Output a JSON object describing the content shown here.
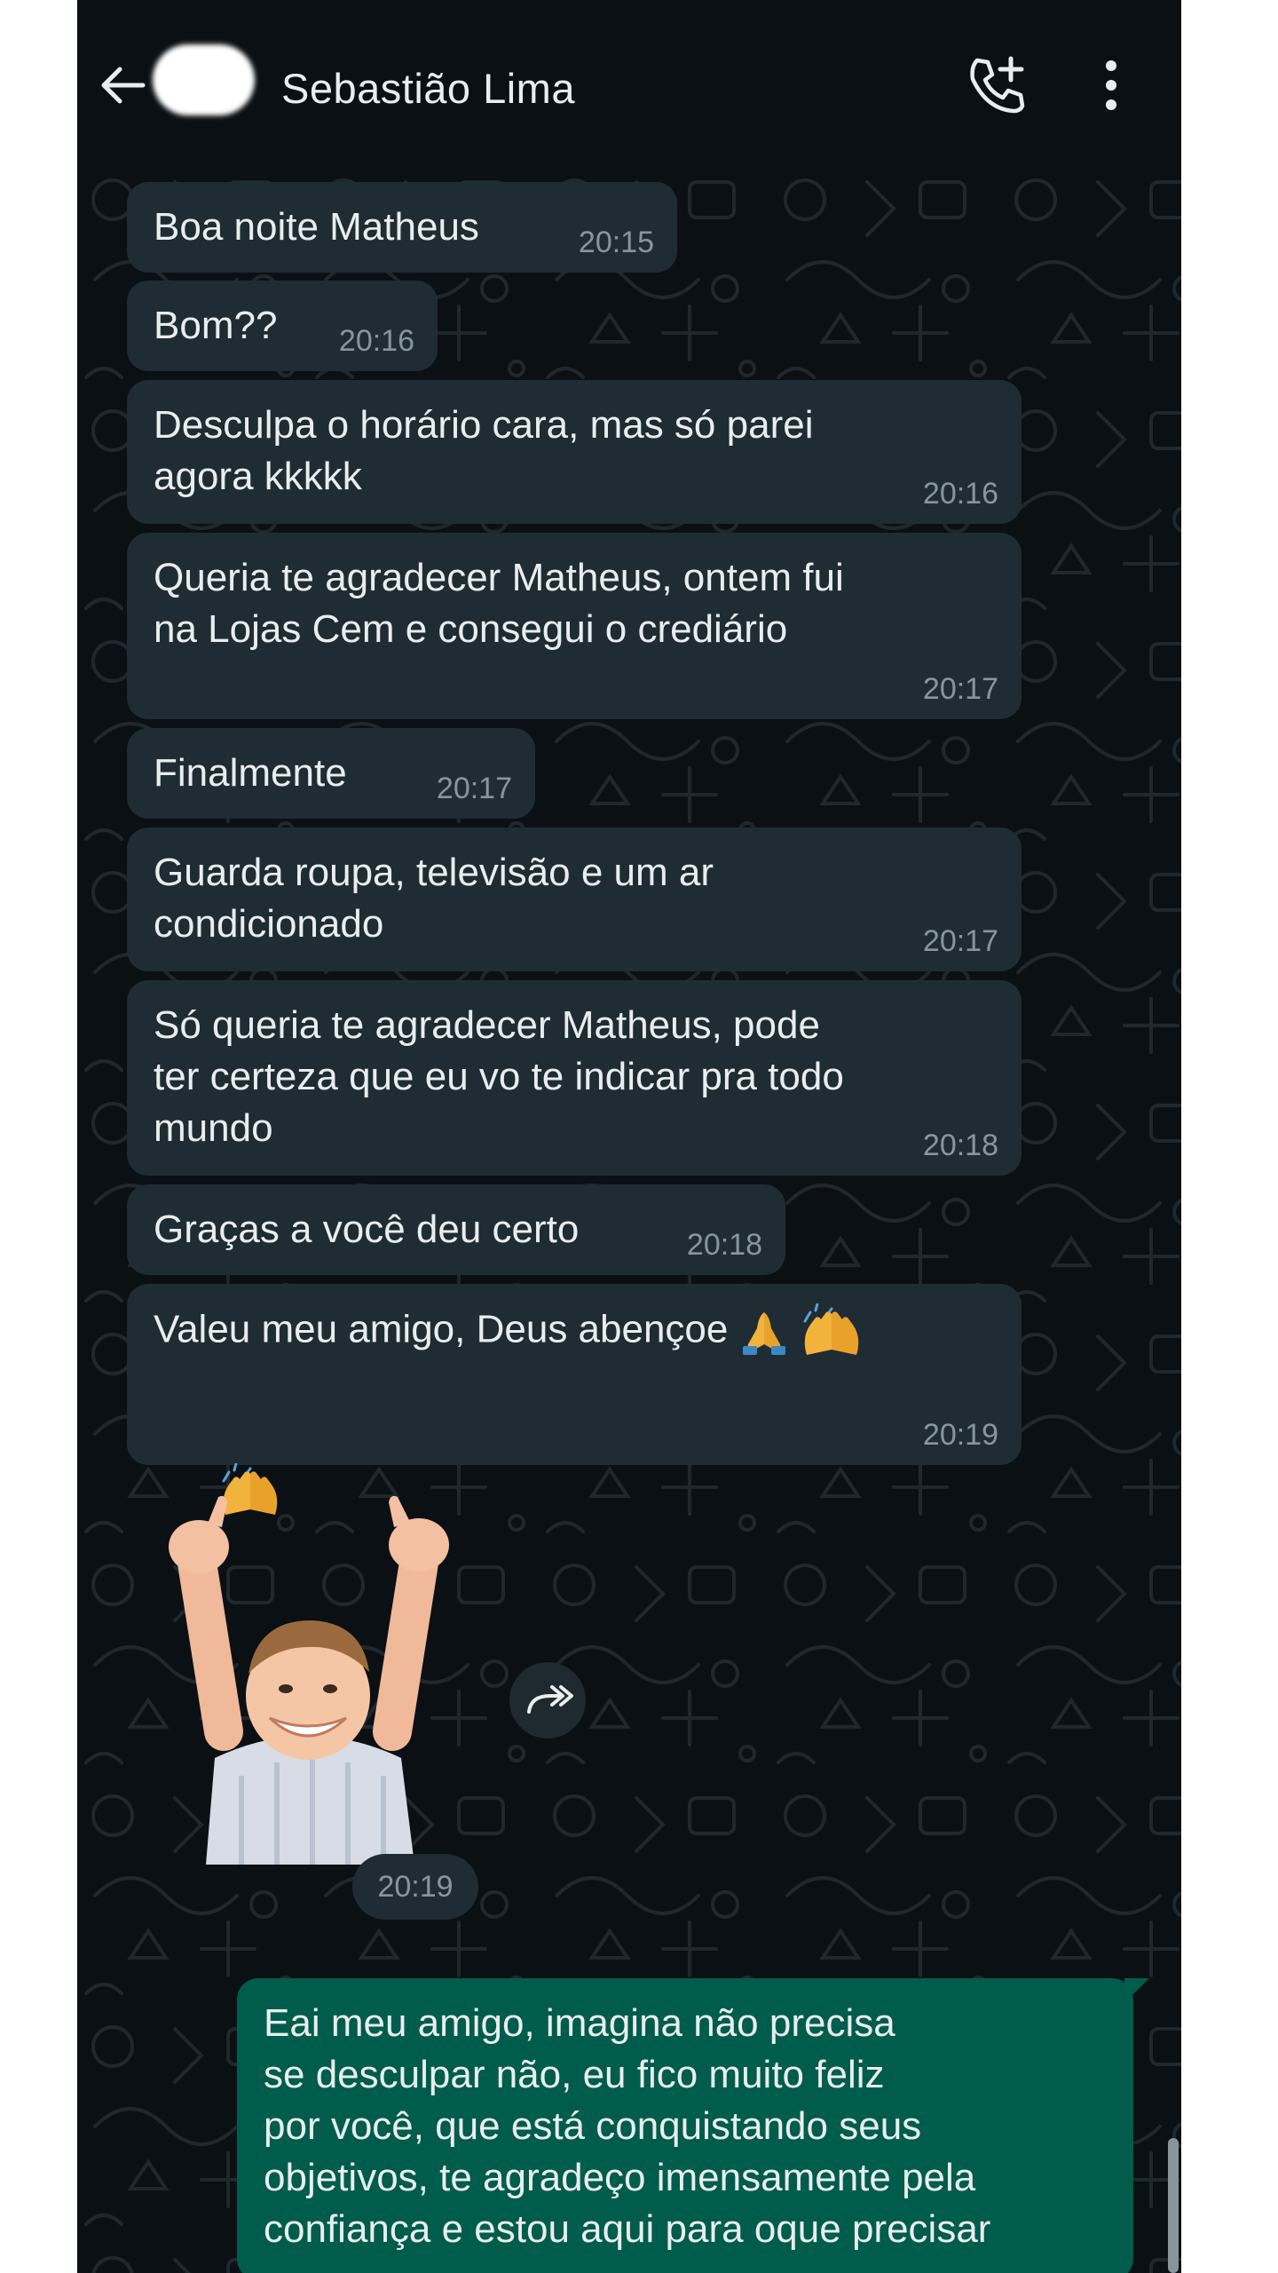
{
  "header": {
    "contact_name": "Sebastião Lima",
    "back_icon": "arrow-left-icon",
    "call_icon": "phone-add-icon",
    "menu_icon": "more-vertical-icon"
  },
  "colors": {
    "background": "#0b1014",
    "incoming_bubble": "#202c33",
    "outgoing_bubble": "#005c4b",
    "text": "#e9edef",
    "timestamp": "#8696a0"
  },
  "messages": [
    {
      "text": "Boa noite Matheus",
      "time": "20:15"
    },
    {
      "text": "Bom??",
      "time": "20:16"
    },
    {
      "text": "Desculpa o horário cara, mas só parei\nagora kkkkk",
      "time": "20:16"
    },
    {
      "text": "Queria te agradecer Matheus, ontem fui\nna Lojas Cem e consegui o crediário",
      "time": "20:17"
    },
    {
      "text": "Finalmente",
      "time": "20:17"
    },
    {
      "text": "Guarda roupa, televisão e um ar\ncondicionado",
      "time": "20:17"
    },
    {
      "text": "Só queria te agradecer Matheus, pode\nter certeza que eu vo te indicar pra todo\nmundo",
      "time": "20:18"
    },
    {
      "text": "Graças a você deu certo",
      "time": "20:18"
    },
    {
      "text": "Valeu meu amigo, Deus abençoe",
      "emojis": [
        "folded-hands-emoji",
        "raising-hands-emoji",
        "raising-hands-emoji"
      ],
      "time": "20:19"
    }
  ],
  "sticker": {
    "description_icon": "thumbs-up-kid-sticker",
    "time": "20:19",
    "forward_icon": "forward-icon"
  },
  "outgoing": {
    "text": "Eai meu amigo, imagina não precisa\nse desculpar não, eu fico muito feliz\npor você, que está conquistando seus\nobjetivos, te agradeço imensamente pela\nconfiança e estou aqui para oque precisar"
  }
}
